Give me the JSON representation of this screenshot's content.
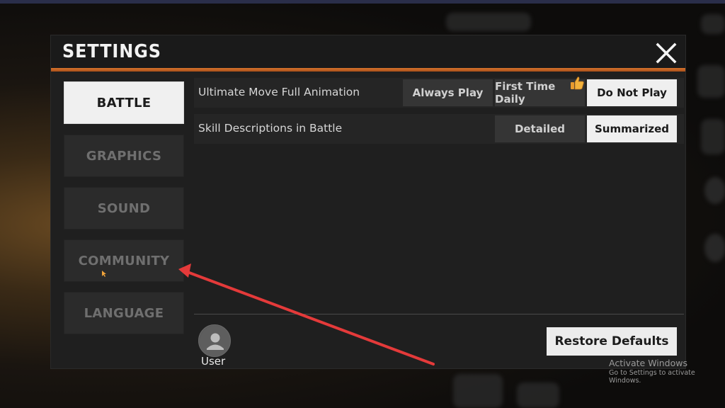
{
  "settings": {
    "title": "SETTINGS",
    "close_icon": "close-x-icon"
  },
  "sidebar": {
    "items": [
      {
        "label": "BATTLE",
        "active": true
      },
      {
        "label": "GRAPHICS",
        "active": false
      },
      {
        "label": "SOUND",
        "active": false
      },
      {
        "label": "COMMUNITY",
        "active": false
      },
      {
        "label": "LANGUAGE",
        "active": false
      }
    ]
  },
  "battle": {
    "rows": [
      {
        "label": "Ultimate Move Full Animation",
        "options": [
          "Always Play",
          "First Time Daily",
          "Do Not Play"
        ],
        "selected": "Do Not Play",
        "recommended": "First Time Daily"
      },
      {
        "label": "Skill Descriptions in Battle",
        "options": [
          "Detailed",
          "Summarized"
        ],
        "selected": "Summarized"
      }
    ]
  },
  "footer": {
    "user_label": "User",
    "restore_label": "Restore Defaults"
  },
  "watermark": {
    "line1": "Activate Windows",
    "line2": "Go to Settings to activate Windows."
  },
  "colors": {
    "accent_orange": "#d8742c",
    "annotation_arrow": "#e43a3a",
    "selected_bg": "#efefef"
  },
  "icons": {
    "thumbs_up": "thumbs-up-icon",
    "avatar": "user-avatar-icon"
  }
}
